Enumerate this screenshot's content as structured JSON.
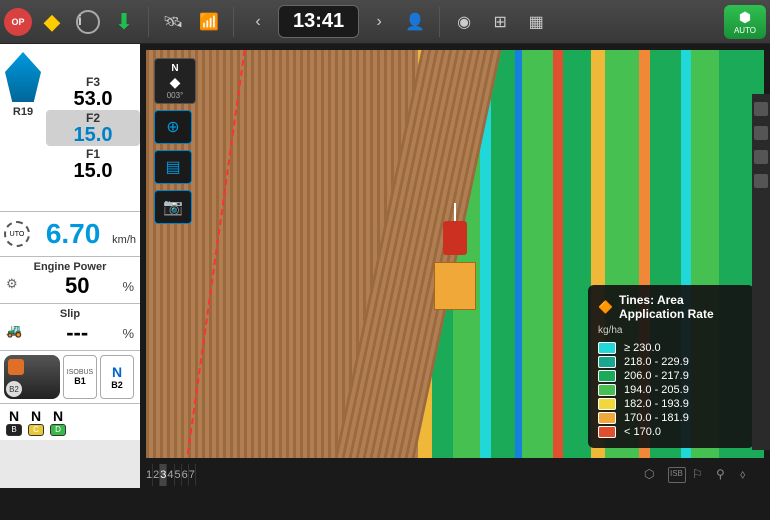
{
  "topbar": {
    "stop": "OP",
    "time": "13:41",
    "auto": "AUTO"
  },
  "sidebar": {
    "gears": {
      "f3_label": "F3",
      "f3_val": "53.0",
      "f2_label": "F2",
      "f2_val": "15.0",
      "f1_label": "F1",
      "f1_val": "15.0",
      "r_label": "R19"
    },
    "speed": {
      "auto_label": "UTO",
      "value": "6.70",
      "unit": "km/h"
    },
    "engine": {
      "title": "Engine Power",
      "value": "50",
      "unit": "%"
    },
    "slip": {
      "title": "Slip",
      "value": "---",
      "unit": "%"
    },
    "isobus": {
      "label": "ISOBUS",
      "b1": "B1",
      "b2": "B2",
      "n": "N"
    },
    "nn": [
      {
        "n": "N",
        "id": "B",
        "color": "#222"
      },
      {
        "n": "N",
        "id": "C",
        "color": "#e8c838"
      },
      {
        "n": "N",
        "id": "D",
        "color": "#38b848"
      }
    ]
  },
  "map": {
    "compass": {
      "n": "N",
      "deg": "003°"
    },
    "tabs": [
      "1",
      "2",
      "3",
      "4",
      "5",
      "6",
      "7"
    ],
    "active_tab": 2
  },
  "legend": {
    "title": "Tines: Area Application Rate",
    "unit": "kg/ha",
    "rows": [
      {
        "color": "#20d8d8",
        "label": "≥ 230.0"
      },
      {
        "color": "#18a890",
        "label": "218.0 - 229.9"
      },
      {
        "color": "#1aaa58",
        "label": "206.0 - 217.9"
      },
      {
        "color": "#46c050",
        "label": "194.0 - 205.9"
      },
      {
        "color": "#f0d838",
        "label": "182.0 - 193.9"
      },
      {
        "color": "#f0a838",
        "label": "170.0 - 181.9"
      },
      {
        "color": "#e05030",
        "label": "< 170.0"
      }
    ]
  }
}
